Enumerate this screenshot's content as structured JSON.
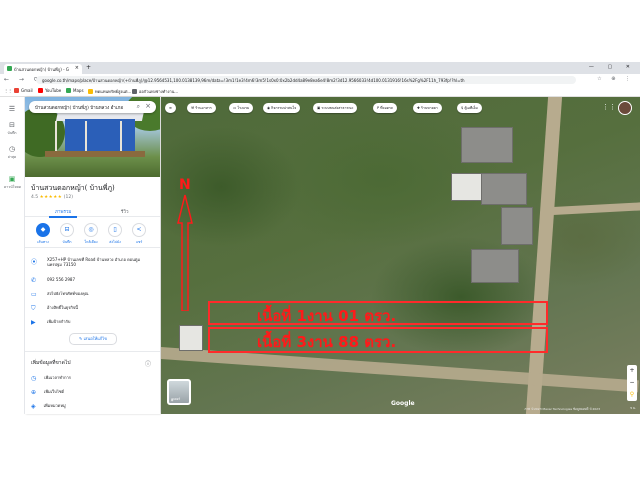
{
  "browser": {
    "tab_title": "บ้านสวนดอกหญ้า( บ้านพี่ภู) - Googl",
    "new_tab": "+",
    "window_controls": "— ▢ ✕",
    "url": "google.co.th/maps/place/บ้านสวนดอกหญ้า(+บ้านพี่ภู)/@12.9564531,100.0138139,96m/data=!3m1!1e3!4m6!3m5!1s0x0:0x2b2dd4a89e8ea6e4!8m2!3d12.9566033!4d100.0131916!16s%2Fg%2F11h_793fp!?hl=th",
    "bookmarks": [
      {
        "label": "Gmail",
        "color": "#ea4335"
      },
      {
        "label": "YouTube",
        "color": "#ff0000"
      },
      {
        "label": "Maps",
        "color": "#34a853"
      },
      {
        "label": "ทดแทนทรัพย์สูงแต่...",
        "color": "#fbbc04"
      },
      {
        "label": "ออกัวแห่งช่างทำงาน...",
        "color": "#5f6368"
      }
    ]
  },
  "rail": {
    "menu": "☰",
    "saved": "บันทึก",
    "recent": "ล่าสุด",
    "get_app": "ดาวน์โหลด"
  },
  "panel": {
    "search_query": "บ้านสวนดอกหญ้า( บ้านพี่ภู) บ้านหลวง อำเภอ",
    "place_name": "บ้านสวนดอกหญ้า( บ้านพี่ภู)",
    "rating": "4.5",
    "stars": "★★★★★",
    "review_count": "(12)",
    "tabs": [
      "ภาพรวม",
      "รีวิว"
    ],
    "actions": [
      {
        "label": "เส้นทาง",
        "icon": "◆"
      },
      {
        "label": "บันทึก",
        "icon": "⊟"
      },
      {
        "label": "ใกล้เคียง",
        "icon": "◎"
      },
      {
        "label": "ส่งไปยัง",
        "icon": "▯"
      },
      {
        "label": "แชร์",
        "icon": "<"
      }
    ],
    "address": "X257+HP บ้านเลขที่ Road บ้านหลวง อำเภอ ดอนตูม นครปฐม 73150",
    "phone": "092 556 2987",
    "maps_app": "ส่งไปยังโทรศัพท์ของคุณ",
    "claim": "อ้างสิทธิ์ในธุรกิจนี้",
    "label_add": "เพิ่มป้ายกำกับ",
    "suggest_edit": "เสนอให้แก้ไข",
    "more_header": "เพิ่มข้อมูลที่ขาดไป",
    "more_items": [
      "เพิ่มเวลาทำการ",
      "เพิ่มเว็บไซต์",
      "เพิ่มหมวดหมู่"
    ]
  },
  "map": {
    "chips": [
      "ร้านอาหาร",
      "โรงแรม",
      "กิจกรรมน่าสนใจ",
      "ระบบขนส่งสาธารณะ",
      "ที่จอดรถ",
      "ร้านขายยา",
      "ตู้เอทีเอ็ม"
    ],
    "north": "N",
    "area_line1": "เนื้อที่ 1งาน 01 ตรว.",
    "area_line2": "เนื้อที่ 3งาน 88 ตรว.",
    "layers_label": "เลเยอร์",
    "google": "Google",
    "attribution": "ภาพ ©2023 Maxar Technologies ข้อมูลแผนที่ ©2023",
    "scale": "5 ม."
  },
  "colors": {
    "annotation_red": "#ff1a1a",
    "accent_blue": "#1a73e8"
  }
}
